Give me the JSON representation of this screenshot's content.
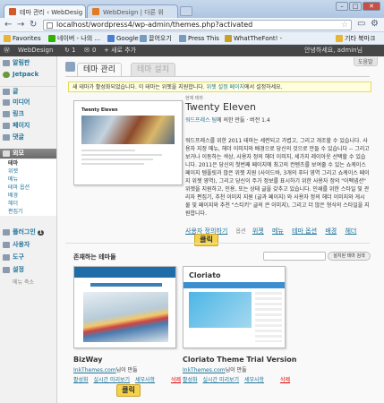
{
  "browser": {
    "tabs": [
      {
        "label": "테마 관리 ‹ WebDesig"
      },
      {
        "label": "WebDesign | 다른 위"
      }
    ],
    "url": "localhost/wordpress4/wp-admin/themes.php?activated",
    "bookmarks": [
      {
        "label": "Favorites",
        "color": "#e8b534"
      },
      {
        "label": "네이버 - 나의 ..."
      },
      {
        "label": "Google"
      },
      {
        "label": "끌어오기"
      },
      {
        "label": "Press This"
      },
      {
        "label": "WhatTheFont! -"
      },
      {
        "label": "기타 북마크"
      }
    ]
  },
  "adminbar": {
    "site": "WebDesign",
    "updates": "1",
    "comments": "0",
    "new": "+ 새로 추가",
    "greeting": "안녕하세요, admin님"
  },
  "menu": {
    "items": [
      {
        "label": "알림판"
      },
      {
        "label": "Jetpack"
      },
      {
        "label": "글"
      },
      {
        "label": "미디어"
      },
      {
        "label": "링크"
      },
      {
        "label": "페이지"
      },
      {
        "label": "댓글"
      },
      {
        "label": "외모"
      },
      {
        "label": "플러그인",
        "badge": "1"
      },
      {
        "label": "사용자"
      },
      {
        "label": "도구"
      },
      {
        "label": "설정"
      }
    ],
    "sub": [
      "테마",
      "위젯",
      "메뉴",
      "테마 옵션",
      "배경",
      "헤더",
      "편집기"
    ],
    "collapse": "메뉴 축소"
  },
  "content": {
    "help": "도움말",
    "tabs": {
      "manage": "테마 관리",
      "install": "테마 설치"
    },
    "notice": {
      "text1": "새 테마가 활성화되었습니다. 이 테마는 위젯을 지원합니다. ",
      "link": "위젯 설정 페이지",
      "text2": "에서 설정하세요."
    },
    "current": {
      "label": "현재 테마",
      "name": "Twenty Eleven",
      "author_link": "워드프레스 팀",
      "author_rest": "에 의한 만듦 · 버전 1.4",
      "description": "워드프레스를 위한 2011 테마는 세련되고 가볍고, 그리고 개조할 수 있습니다. 사용자 지정 메뉴, 헤더 이미지와 배경으로 당신의 것으로 만들 수 있습니다 -- 그리고 보거나 이동하는 색상, 사용자 정의 헤더 이미지, 세가지 레이아웃 선택할 수 있습니다. 2011은 당신의 첫번째 페이지에 최고의 컨텐츠를 보여줄 수 있는 쇼케이스 페이지 템플릿과 많은 위젯 지원 (사이드바, 3개의 푸터 영역 그리고 쇼케이스 페이지 위젯 영역), 그리고 당신이 주가 정보를 표시하기 위한 사용자 정의 \"이펙넵션\" 위젯을 지원하고, 인용, 또는 상태 글을 갖추고 있습니다. 인쇄를 위한 스타일 및 관리자 편집기, 추천 이미지 지원 (글과 페이지) 와 사용자 정의 헤더 이미지와 게시물 및 페이지와 추천 \"스티키\" 글의 큰 이미지), 그리고 더 많은 형식의 스타일을 지원합니다.",
      "options_label": "옵션",
      "options": [
        "사용자 정의하기",
        "위젯",
        "메뉴",
        "테마 옵션",
        "배경",
        "헤더"
      ]
    },
    "callout": "클릭",
    "available": {
      "title": "존재하는 테마들",
      "search_btn": "설치된 테마 검색",
      "themes": [
        {
          "name": "BizWay",
          "author_link": "InkThemes.com",
          "author_rest": "님이 만듦",
          "actions": [
            "활성화",
            "실시간 미리보기",
            "세부사항"
          ],
          "delete": "삭제"
        },
        {
          "name": "Cloriato Theme Trial Version",
          "logo": "Cloriato",
          "author_link": "InkThemes.com",
          "author_rest": "님이 만듦",
          "actions": [
            "활성화",
            "실시간 미리보기",
            "세부사항"
          ],
          "delete": "삭제"
        }
      ]
    }
  },
  "colors": {
    "link": "#21759b",
    "adminbar": "#464646",
    "callout": "#f4d24a",
    "notice": "#ffffe0"
  }
}
